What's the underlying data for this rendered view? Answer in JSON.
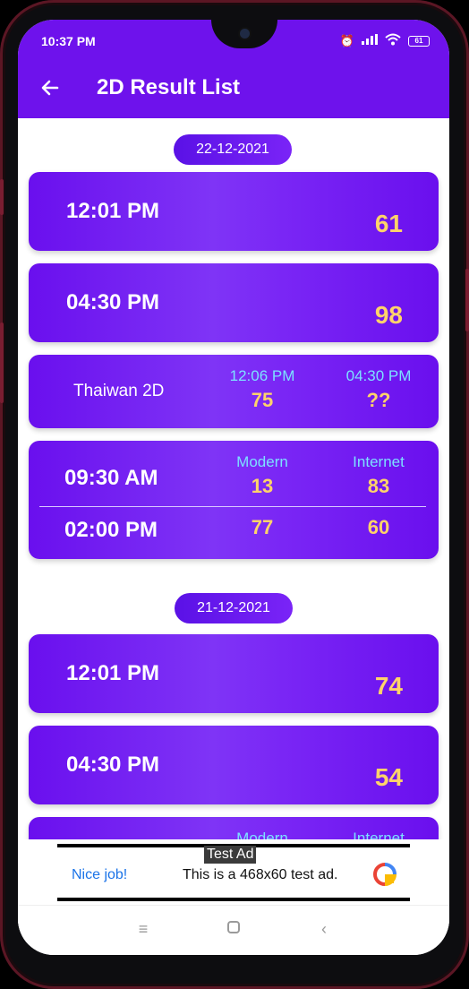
{
  "status_bar": {
    "time": "10:37 PM",
    "battery": "61"
  },
  "app_bar": {
    "title": "2D Result List",
    "color": "#6e12ec"
  },
  "sections": [
    {
      "date": "22-12-2021",
      "results": [
        {
          "time": "12:01 PM",
          "value": "61"
        },
        {
          "time": "04:30 PM",
          "value": "98"
        }
      ],
      "thaiwan": {
        "label": "Thaiwan 2D",
        "col1_head": "12:06 PM",
        "col1_val": "75",
        "col2_head": "04:30 PM",
        "col2_val": "??"
      },
      "modern_internet": {
        "head_modern": "Modern",
        "head_internet": "Internet",
        "rows": [
          {
            "time": "09:30 AM",
            "modern": "13",
            "internet": "83"
          },
          {
            "time": "02:00 PM",
            "modern": "77",
            "internet": "60"
          }
        ]
      }
    },
    {
      "date": "21-12-2021",
      "results": [
        {
          "time": "12:01 PM",
          "value": "74"
        },
        {
          "time": "04:30 PM",
          "value": "54"
        }
      ],
      "partial": {
        "head_modern": "Modern",
        "head_internet": "Internet"
      }
    }
  ],
  "ad": {
    "tag": "Test Ad",
    "nice": "Nice job!",
    "text": "This is a 468x60 test ad."
  },
  "colors": {
    "accent": "#6e12ec",
    "value_yellow": "#ffd36a",
    "header_cyan": "#7ce1ff"
  }
}
